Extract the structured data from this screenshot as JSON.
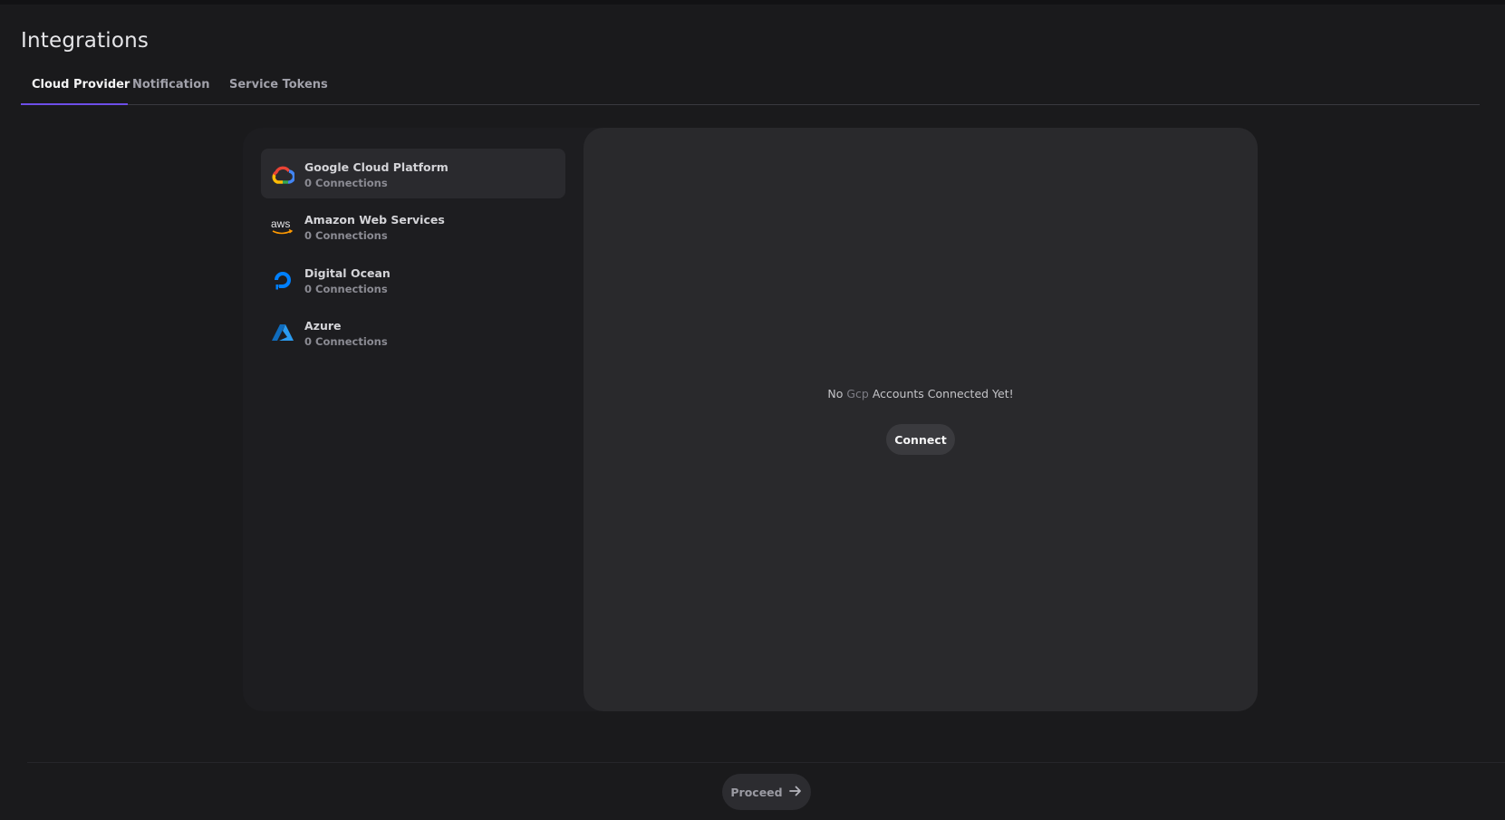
{
  "page": {
    "title": "Integrations"
  },
  "tabs": [
    {
      "label": "Cloud Provider",
      "active": true
    },
    {
      "label": "Notification",
      "active": false
    },
    {
      "label": "Service Tokens",
      "active": false
    }
  ],
  "providers": [
    {
      "name": "Google Cloud Platform",
      "connections": "0 Connections",
      "icon": "google-cloud-icon",
      "selected": true
    },
    {
      "name": "Amazon Web Services",
      "connections": "0 Connections",
      "icon": "aws-icon",
      "logo_text": "aws",
      "selected": false
    },
    {
      "name": "Digital Ocean",
      "connections": "0 Connections",
      "icon": "digitalocean-icon",
      "selected": false
    },
    {
      "name": "Azure",
      "connections": "0 Connections",
      "icon": "azure-icon",
      "selected": false
    }
  ],
  "detail": {
    "message_prefix": "No",
    "provider_key": "Gcp",
    "message_suffix": "Accounts Connected Yet!",
    "connect_label": "Connect"
  },
  "footer": {
    "proceed_label": "Proceed",
    "proceed_icon": "arrow-right-icon"
  },
  "colors": {
    "accent": "#6d4ee8",
    "background": "#1a1a1c",
    "panel": "#29292c",
    "aws_orange": "#ff9900",
    "digitalocean_blue": "#0080ff",
    "azure_blue": "#0078d4"
  }
}
